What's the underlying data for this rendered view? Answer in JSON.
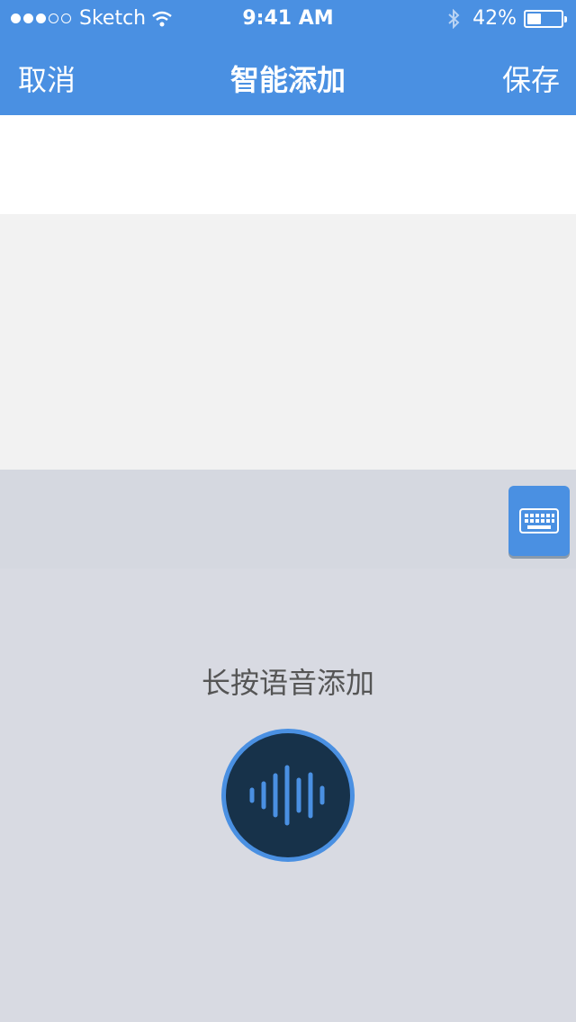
{
  "status_bar": {
    "carrier": "Sketch",
    "time": "9:41 AM",
    "battery_percent": "42%",
    "battery_level": 0.42
  },
  "nav": {
    "cancel_label": "取消",
    "title": "智能添加",
    "save_label": "保存"
  },
  "voice": {
    "hint": "长按语音添加"
  },
  "colors": {
    "accent": "#4a90e2",
    "mic_bg": "#17324a",
    "panel_bg": "#d8dae2"
  },
  "icons": {
    "keyboard": "keyboard-icon",
    "voice": "sound-wave-icon",
    "wifi": "wifi-icon",
    "bluetooth": "bluetooth-icon",
    "battery": "battery-icon"
  }
}
